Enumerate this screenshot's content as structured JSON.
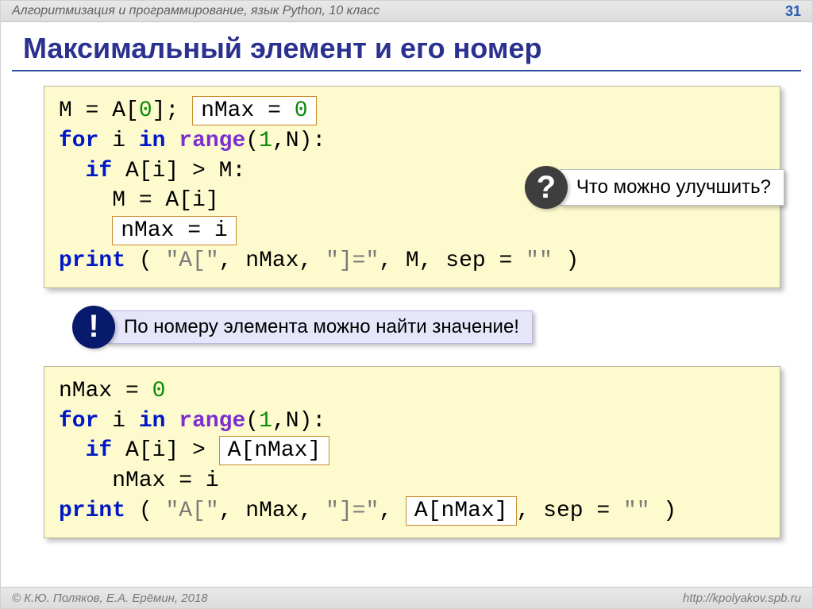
{
  "header": {
    "left": "Алгоритмизация и программирование, язык Python, 10 класс",
    "page": "31"
  },
  "title": "Максимальный элемент и его номер",
  "box_nmax0": "nMax = 0",
  "box_nmaxi": "nMax = i",
  "box_anmax1": "A[nMax]",
  "box_anmax2": "A[nMax]",
  "question": {
    "mark": "?",
    "text": "Что можно улучшить?"
  },
  "note": {
    "mark": "!",
    "text": "По номеру элемента можно найти значение!"
  },
  "code1": {
    "l1a": "M = A[",
    "l1b": "0",
    "l1c": "]; ",
    "l2a": "for",
    "l2b": " i ",
    "l2c": "in",
    "l2d": " ",
    "l2e": "range",
    "l2f": "(",
    "l2g": "1",
    "l2h": ",N):",
    "l3a": "  if",
    "l3b": " A[i] > M:",
    "l4": "    M = A[i]",
    "l6a": "print",
    "l6b": " ( ",
    "l6c": "\"A[\"",
    "l6d": ", nMax, ",
    "l6e": "\"]=\"",
    "l6f": ", M, sep = ",
    "l6g": "\"\"",
    "l6h": " )"
  },
  "code2": {
    "l1a": "nMax = ",
    "l1b": "0",
    "l2a": "for",
    "l2b": " i ",
    "l2c": "in",
    "l2d": " ",
    "l2e": "range",
    "l2f": "(",
    "l2g": "1",
    "l2h": ",N):",
    "l3a": "  if",
    "l3b": " A[i] > ",
    "l4": "    nMax = i",
    "l5a": "print",
    "l5b": " ( ",
    "l5c": "\"A[\"",
    "l5d": ", nMax, ",
    "l5e": "\"]=\"",
    "l5f": ",",
    "l5g": " sep = ",
    "l5h": "\"\"",
    "l5i": " )"
  },
  "footer": {
    "left": "© К.Ю. Поляков, Е.А. Ерёмин, 2018",
    "right": "http://kpolyakov.spb.ru"
  }
}
